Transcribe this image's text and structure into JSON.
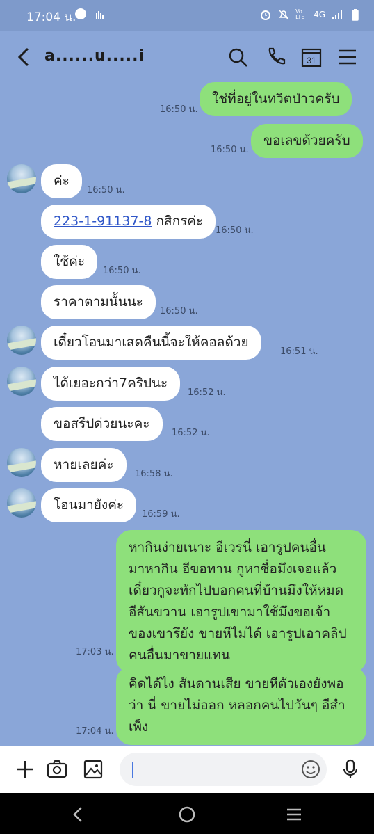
{
  "status_bar": {
    "time": "17:04 น.",
    "network": "4G",
    "volte": "Vo LTE"
  },
  "header": {
    "title": "a......u.....i"
  },
  "messages": [
    {
      "side": "out",
      "text": "ใช่ที่อยู่ในทวิตป่าวครับ",
      "time": "16:50 น."
    },
    {
      "side": "out",
      "text": "ขอเลขด้วยครับ",
      "time": "16:50 น."
    },
    {
      "side": "in",
      "text": "ค่ะ",
      "time": "16:50 น."
    },
    {
      "side": "in",
      "link": "223-1-91137-8",
      "text": " กสิกรค่ะ",
      "time": "16:50 น."
    },
    {
      "side": "in",
      "text": "ใช้ค่ะ",
      "time": "16:50 น."
    },
    {
      "side": "in",
      "text": "ราคาตามนั้นนะ",
      "time": "16:50 น."
    },
    {
      "side": "in",
      "text": "เดี๋ยวโอนมาเสดคืนนี้จะให้คอลด้วย",
      "time": "16:51 น."
    },
    {
      "side": "in",
      "text": "ได้เยอะกว่า7คริปนะ",
      "time": "16:52 น."
    },
    {
      "side": "in",
      "text": "ขอสรีปด่วยนะคะ",
      "time": "16:52 น."
    },
    {
      "side": "in",
      "text": "หายเลยค่ะ",
      "time": "16:58 น."
    },
    {
      "side": "in",
      "text": "โอนมายังค่ะ",
      "time": "16:59 น."
    },
    {
      "side": "out",
      "lines": [
        "หากินง่ายเนาะ อีเวรนี่ เอารูปคนอื่น",
        "มาหากิน อีขอทาน กูหาชื่อมึงเจอแล้ว",
        "เดี๋ยวกูจะทักไปบอกคนที่บ้านมึงให้หมด",
        "อีสันขวาน เอารูปเขามาใช้มึงขอเจ้า",
        "ของเขารึยัง ขายหีไม่ได้ เอารูปเอาคลิป",
        "คนอื่นมาขายแทน"
      ],
      "time": "17:03 น."
    },
    {
      "side": "out",
      "lines": [
        "คิดได้ไง สันดานเสีย ขายหีตัวเองยังพอ",
        "ว่า นี่ ขายไม่ออก หลอกคนไปวันๆ อีสำ",
        "เพ็ง"
      ],
      "time": "17:04 น."
    }
  ],
  "input": {
    "value": "",
    "placeholder": ""
  },
  "colors": {
    "background": "#8aa6d8",
    "outgoing_bubble": "#8ee07b",
    "incoming_bubble": "#ffffff",
    "link": "#2f56c8"
  },
  "icons": {
    "back": "back-arrow-icon",
    "search": "search-icon",
    "call": "phone-icon",
    "calendar": "calendar-icon",
    "menu": "menu-icon",
    "add": "plus-icon",
    "camera": "camera-icon",
    "image": "image-icon",
    "emoji": "emoji-icon",
    "mic": "microphone-icon"
  },
  "calendar_day": "31"
}
